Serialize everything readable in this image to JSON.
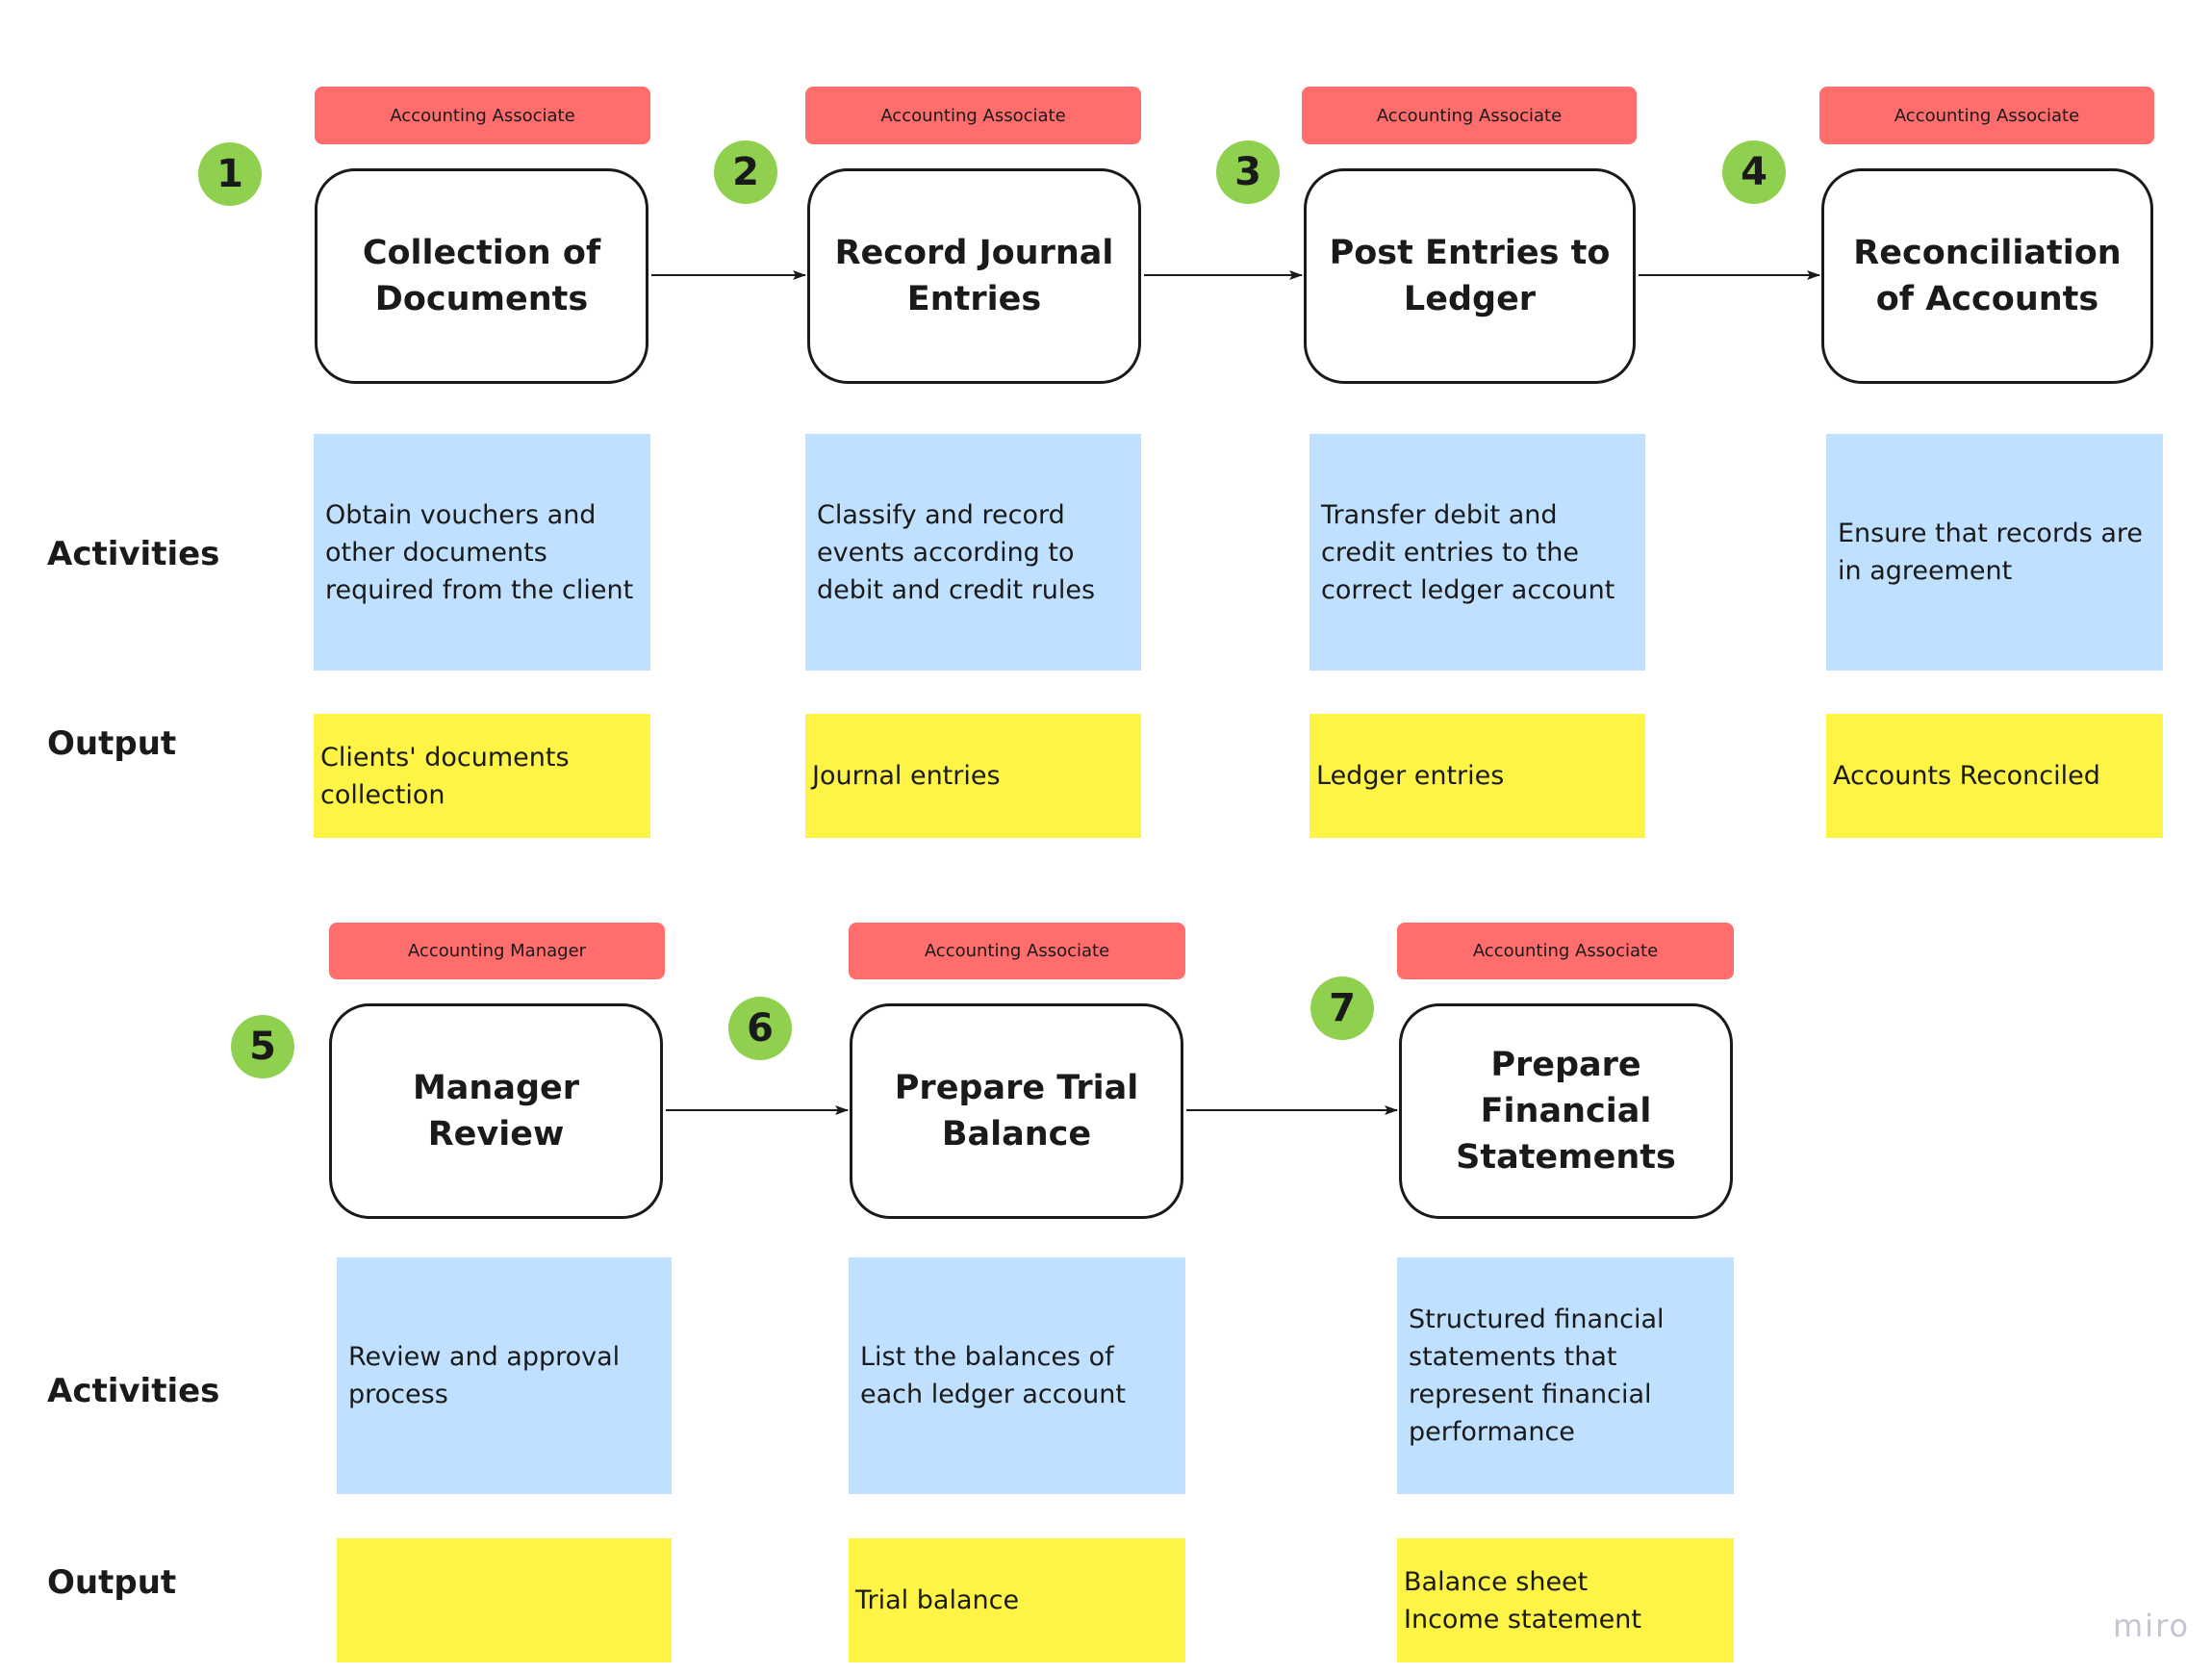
{
  "board": {
    "brand_logo": "miro",
    "row_labels": {
      "activities": "Activities",
      "output": "Output"
    }
  },
  "colors": {
    "role_tag": "#ff6d6d",
    "step_badge": "#8fd14f",
    "activity_note": "#bfe0ff",
    "output_note": "#fef445"
  },
  "steps": [
    {
      "number": "1",
      "role": "Accounting Associate",
      "title": "Collection of Documents",
      "activity": "Obtain vouchers and other documents required from the client",
      "output": "Clients' documents collection"
    },
    {
      "number": "2",
      "role": "Accounting Associate",
      "title": "Record Journal Entries",
      "activity": "Classify and record events according to debit and credit rules",
      "output": "Journal entries"
    },
    {
      "number": "3",
      "role": "Accounting Associate",
      "title": "Post Entries to Ledger",
      "activity": "Transfer debit and credit entries to the correct ledger account",
      "output": "Ledger entries"
    },
    {
      "number": "4",
      "role": "Accounting Associate",
      "title": "Reconciliation of Accounts",
      "activity": "Ensure that records are in agreement",
      "output": "Accounts Reconciled"
    },
    {
      "number": "5",
      "role": "Accounting Manager",
      "title": "Manager Review",
      "activity": "Review and approval process",
      "output": ""
    },
    {
      "number": "6",
      "role": "Accounting Associate",
      "title": "Prepare Trial Balance",
      "activity": "List the balances of each ledger account",
      "output": "Trial balance"
    },
    {
      "number": "7",
      "role": "Accounting Associate",
      "title": "Prepare Financial Statements",
      "activity": "Structured financial statements that represent financial performance",
      "output": "Balance sheet\nIncome statement"
    }
  ],
  "connectors": [
    {
      "from": "1",
      "to": "2"
    },
    {
      "from": "2",
      "to": "3"
    },
    {
      "from": "3",
      "to": "4"
    },
    {
      "from": "5",
      "to": "6"
    },
    {
      "from": "6",
      "to": "7"
    }
  ]
}
